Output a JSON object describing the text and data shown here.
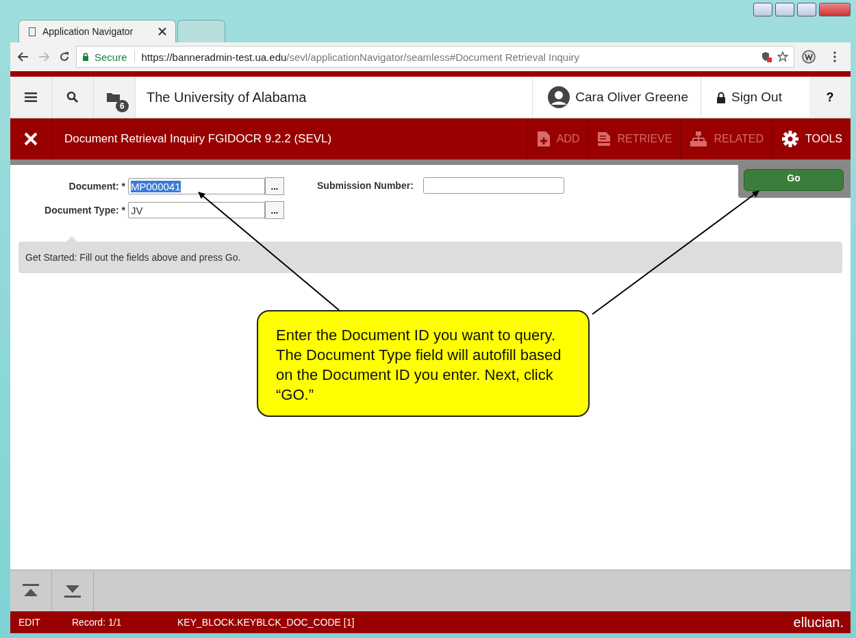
{
  "browser": {
    "tabs": [
      {
        "title": "Application Navigator",
        "selected": true
      },
      {
        "selected": false
      }
    ],
    "address": {
      "secure_label": "Secure",
      "url_host": "https://banneradmin-test.ua.edu",
      "url_path": "/sevl/applicationNavigator/seamless#Document Retrieval Inquiry"
    }
  },
  "header": {
    "recent_count": "6",
    "institution": "The University of Alabama",
    "user": "Cara Oliver Greene",
    "sign_out": "Sign Out",
    "help": "?"
  },
  "toolbar": {
    "title": "Document Retrieval Inquiry FGIDOCR 9.2.2 (SEVL)",
    "actions": [
      {
        "kind": "add",
        "label": "ADD",
        "disabled": true
      },
      {
        "kind": "retrieve",
        "label": "RETRIEVE",
        "disabled": true
      },
      {
        "kind": "related",
        "label": "RELATED",
        "disabled": true
      },
      {
        "kind": "tools",
        "label": "TOOLS",
        "disabled": false
      }
    ]
  },
  "form": {
    "fields": [
      {
        "label": "Document: *",
        "value": "MP000041",
        "selected": true,
        "lookup": "..."
      },
      {
        "label": "Document Type: *",
        "value": "JV",
        "selected": false,
        "lookup": "..."
      }
    ],
    "submission": {
      "label": "Submission Number:"
    },
    "go": "Go"
  },
  "message": "Get Started: Fill out the fields above and press Go.",
  "callout": "Enter the Document ID you want to query.  The Document Type field will autofill based on the Document ID you enter. Next, click “GO.”",
  "status_bar": {
    "mode": "EDIT",
    "record": "Record: 1/1",
    "field": "KEY_BLOCK.KEYBLCK_DOC_CODE [1]",
    "brand": "ellucian."
  }
}
